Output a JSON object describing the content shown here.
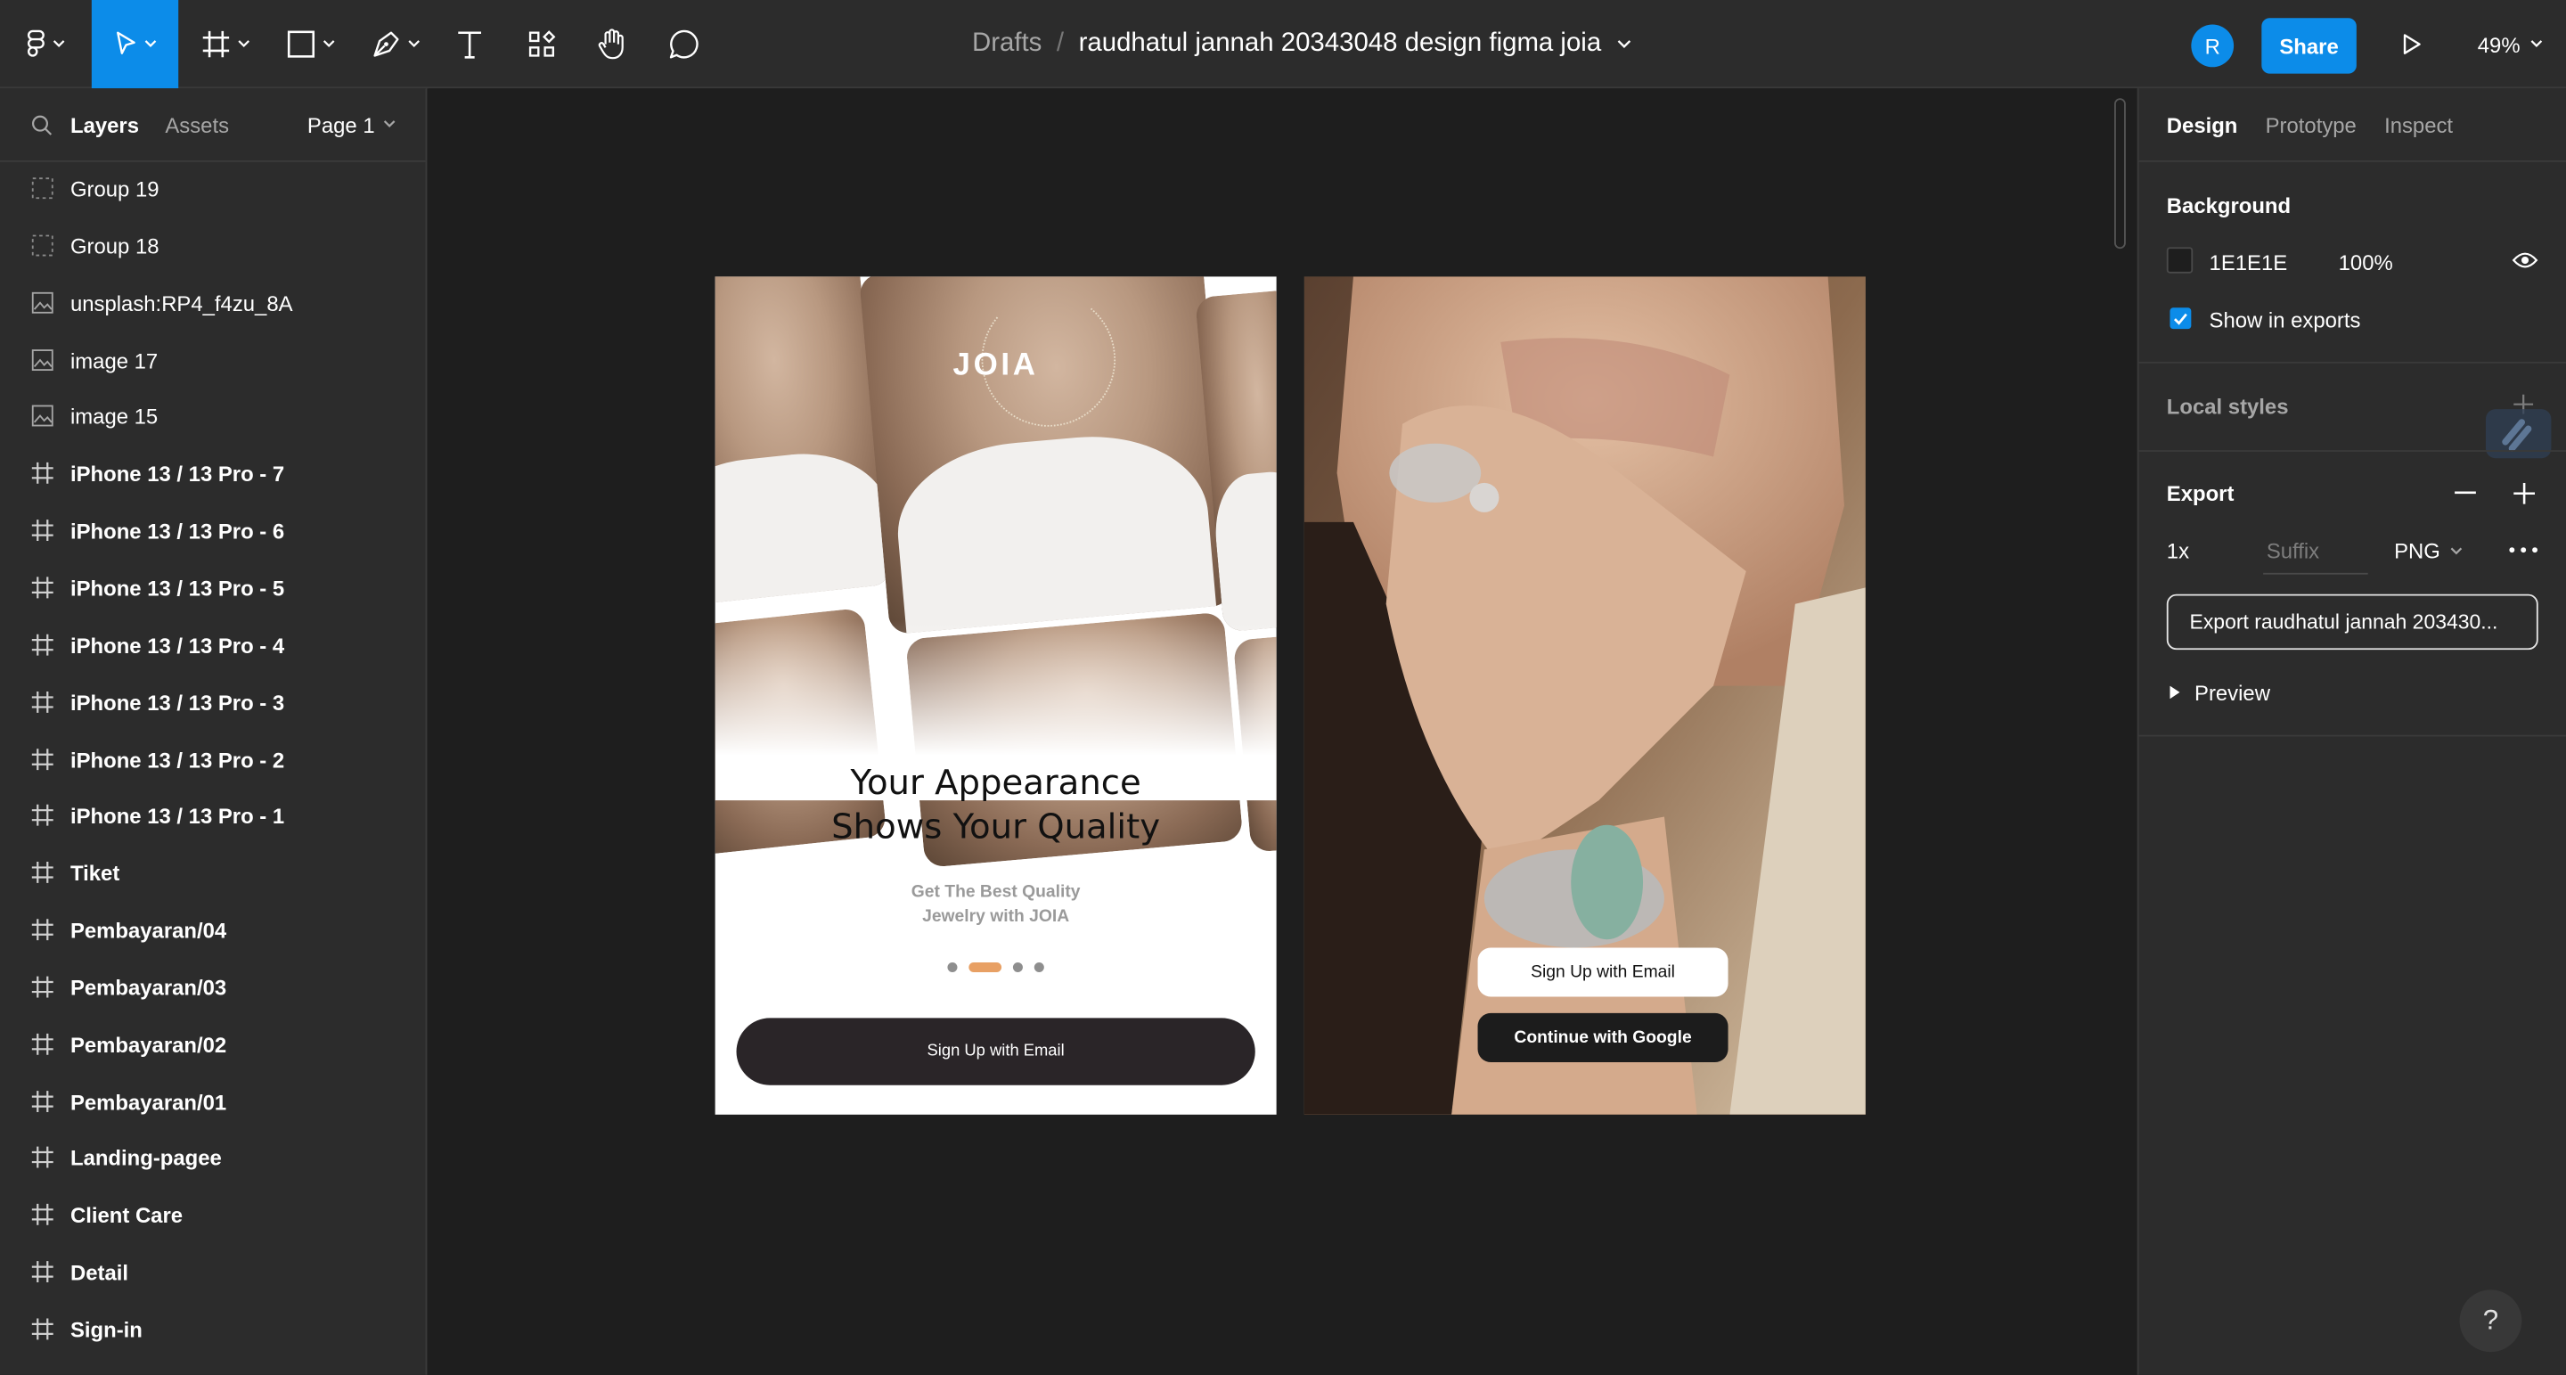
{
  "toolbar": {
    "breadcrumb_root": "Drafts",
    "breadcrumb_separator": "/",
    "file_name": "raudhatul jannah 20343048 design figma joia",
    "avatar_initial": "R",
    "share_label": "Share",
    "zoom_level": "49%",
    "accent_color": "#0c8ce9"
  },
  "left_panel": {
    "tabs": [
      "Layers",
      "Assets"
    ],
    "active_tab": "Layers",
    "page_selector": "Page 1",
    "layers": [
      {
        "name": "Group 19",
        "icon": "group-icon"
      },
      {
        "name": "Group 18",
        "icon": "group-icon"
      },
      {
        "name": "unsplash:RP4_f4zu_8A",
        "icon": "image-icon"
      },
      {
        "name": "image 17",
        "icon": "image-icon"
      },
      {
        "name": "image 15",
        "icon": "image-icon"
      },
      {
        "name": "iPhone 13 / 13 Pro - 7",
        "icon": "frame-icon"
      },
      {
        "name": "iPhone 13 / 13 Pro - 6",
        "icon": "frame-icon"
      },
      {
        "name": "iPhone 13 / 13 Pro - 5",
        "icon": "frame-icon"
      },
      {
        "name": "iPhone 13 / 13 Pro - 4",
        "icon": "frame-icon"
      },
      {
        "name": "iPhone 13 / 13 Pro - 3",
        "icon": "frame-icon"
      },
      {
        "name": "iPhone 13 / 13 Pro - 2",
        "icon": "frame-icon"
      },
      {
        "name": "iPhone 13 / 13 Pro - 1",
        "icon": "frame-icon"
      },
      {
        "name": "Tiket",
        "icon": "frame-icon"
      },
      {
        "name": "Pembayaran/04",
        "icon": "frame-icon"
      },
      {
        "name": "Pembayaran/03",
        "icon": "frame-icon"
      },
      {
        "name": "Pembayaran/02",
        "icon": "frame-icon"
      },
      {
        "name": "Pembayaran/01",
        "icon": "frame-icon"
      },
      {
        "name": "Landing-pagee",
        "icon": "frame-icon"
      },
      {
        "name": "Client Care",
        "icon": "frame-icon"
      },
      {
        "name": "Detail",
        "icon": "frame-icon"
      },
      {
        "name": "Sign-in",
        "icon": "frame-icon"
      }
    ]
  },
  "canvas": {
    "frame1": {
      "brand": "JOIA",
      "headline_line1": "Your Appearance",
      "headline_line2": "Shows Your Quality",
      "sub_line1": "Get The Best Quality",
      "sub_line2": "Jewelry with JOIA",
      "active_dot": 1,
      "dot_count": 4,
      "accent": "#e8a064",
      "button_label": "Sign Up with Email"
    },
    "frame2": {
      "button_email": "Sign Up with Email",
      "button_google": "Continue with Google"
    }
  },
  "right_panel": {
    "tabs": [
      "Design",
      "Prototype",
      "Inspect"
    ],
    "active_tab": "Design",
    "background": {
      "title": "Background",
      "hex": "1E1E1E",
      "opacity": "100%",
      "show_in_exports_label": "Show in exports",
      "show_in_exports": true
    },
    "local_styles_title": "Local styles",
    "export": {
      "title": "Export",
      "scale": "1x",
      "suffix_placeholder": "Suffix",
      "format": "PNG",
      "button_label": "Export raudhatul jannah 203430...",
      "preview_label": "Preview"
    }
  },
  "help_label": "?"
}
